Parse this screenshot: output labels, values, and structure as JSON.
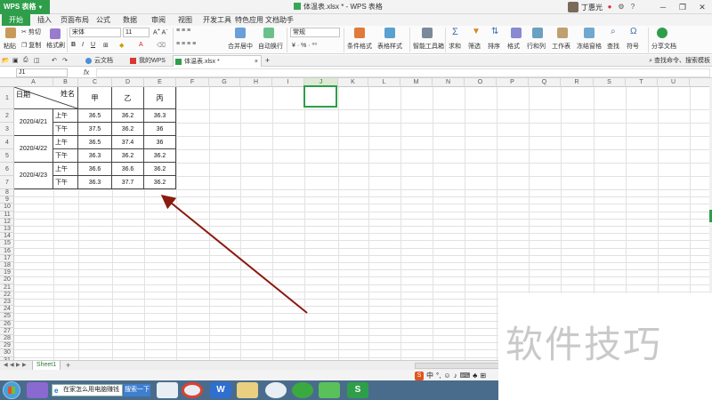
{
  "titlebar": {
    "app_name": "WPS 表格",
    "document_title": "体温表.xlsx * - WPS 表格",
    "user_name": "丁惠光"
  },
  "menu": [
    "开始",
    "插入",
    "页面布局",
    "公式",
    "数据",
    "审阅",
    "视图",
    "开发工具",
    "特色应用",
    "文档助手"
  ],
  "ribbon": {
    "paste": "粘贴",
    "cut": "剪切",
    "copy": "复制",
    "format_painter": "格式刷",
    "font_name": "宋体",
    "font_size": "11",
    "merge_center": "合并居中",
    "wrap_text": "自动换行",
    "number_format": "常规",
    "conditional_format": "条件格式",
    "table_style": "表格样式",
    "smart_toolbox": "智能工具箱",
    "sum": "求和",
    "filter": "筛选",
    "sort": "排序",
    "format": "格式",
    "rows_cols": "行和列",
    "worksheet": "工作表",
    "freeze": "冻结窗格",
    "find": "查找",
    "symbol": "符号",
    "share": "分享文档"
  },
  "doc_tabs": [
    "云文档",
    "我的WPS",
    "体温表.xlsx *"
  ],
  "command_search": "查找命令、搜索模板",
  "formula_bar": {
    "name_box": "J1",
    "fx": "fx",
    "formula": ""
  },
  "columns": [
    "A",
    "B",
    "C",
    "D",
    "E",
    "F",
    "G",
    "H",
    "I",
    "J",
    "K",
    "L",
    "M",
    "N",
    "O",
    "P",
    "Q",
    "R",
    "S",
    "T",
    "U"
  ],
  "rows": [
    "1",
    "2",
    "3",
    "4",
    "5",
    "6",
    "7",
    "8",
    "9",
    "10",
    "11",
    "12",
    "13",
    "14",
    "15",
    "16",
    "17",
    "18",
    "19",
    "20",
    "21",
    "22",
    "23",
    "24",
    "25",
    "26",
    "27",
    "28",
    "29",
    "30",
    "31",
    "32",
    "33",
    "34",
    "35",
    "36"
  ],
  "table": {
    "corner_top": "姓名",
    "corner_bottom": "日期",
    "headers": [
      "甲",
      "乙",
      "丙"
    ],
    "groups": [
      {
        "date": "2020/4/21",
        "rows": [
          {
            "period": "上午",
            "values": [
              "36.5",
              "36.2",
              "36.3"
            ]
          },
          {
            "period": "下午",
            "values": [
              "37.5",
              "36.2",
              "36"
            ]
          }
        ]
      },
      {
        "date": "2020/4/22",
        "rows": [
          {
            "period": "上午",
            "values": [
              "36.5",
              "37.4",
              "36"
            ]
          },
          {
            "period": "下午",
            "values": [
              "36.3",
              "36.2",
              "36.2"
            ]
          }
        ]
      },
      {
        "date": "2020/4/23",
        "rows": [
          {
            "period": "上午",
            "values": [
              "36.6",
              "36.6",
              "36.2"
            ]
          },
          {
            "period": "下午",
            "values": [
              "36.3",
              "37.7",
              "36.2"
            ]
          }
        ]
      }
    ]
  },
  "sheets": {
    "active": "Sheet1",
    "add": "+"
  },
  "ime": {
    "logo": "S",
    "label": "中"
  },
  "taskbar": {
    "search_text": "在家怎么用电脑赚钱",
    "search_button": "搜索一下"
  },
  "watermark": "软件技巧",
  "colors": {
    "wps_green": "#2e9e4a",
    "arrow": "#8b1a10"
  }
}
